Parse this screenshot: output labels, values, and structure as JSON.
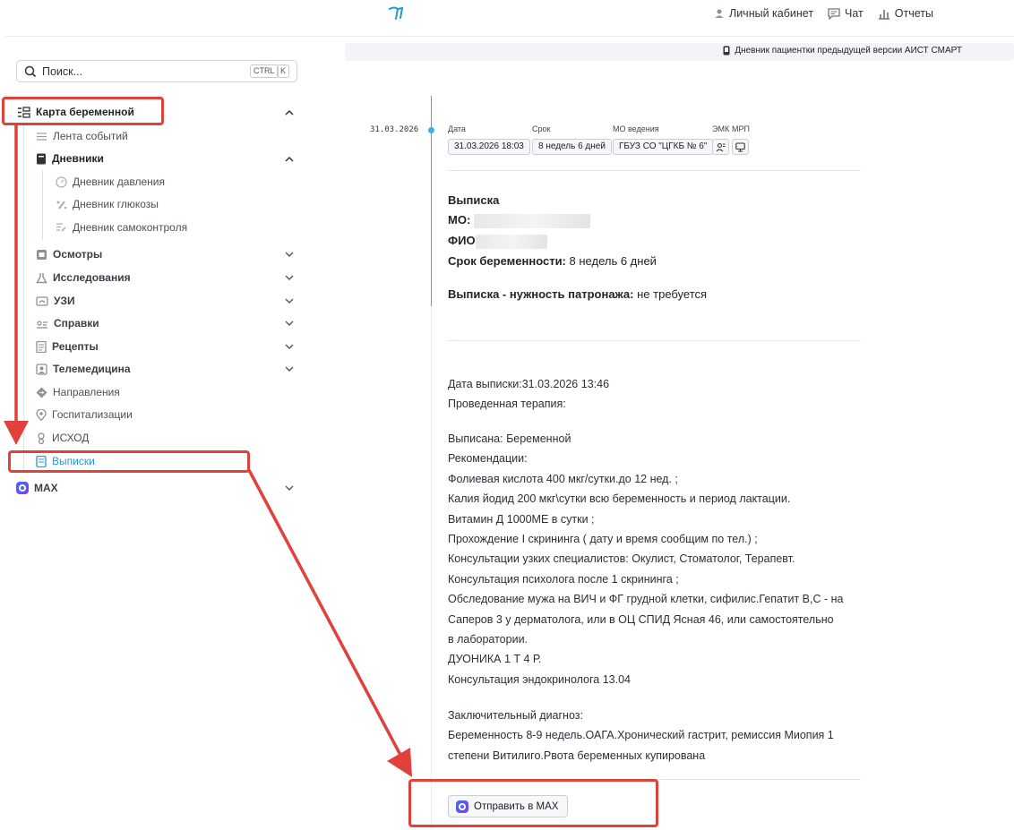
{
  "header": {
    "logo_icon": "stork-logo-icon",
    "nav": [
      {
        "label": "Личный кабинет",
        "icon": "user-icon"
      },
      {
        "label": "Чат",
        "icon": "chat-icon"
      },
      {
        "label": "Отчеты",
        "icon": "chart-icon"
      }
    ]
  },
  "banner": {
    "label": "Дневник пациентки предыдущей версии АИСТ СМАРТ",
    "icon": "phone-icon"
  },
  "search": {
    "placeholder": "Поиск...",
    "kbd1": "CTRL",
    "kbd2": "K"
  },
  "sidebar": {
    "root_label": "Карта беременной",
    "items": {
      "events": "Лента событий",
      "diaries": "Дневники",
      "pressure": "Дневник давления",
      "glucose": "Дневник глюкозы",
      "selfcontrol": "Дневник самоконтроля",
      "exams": "Осмотры",
      "research": "Исследования",
      "uzi": "УЗИ",
      "certificates": "Справки",
      "recipes": "Рецепты",
      "telemed": "Телемедицина",
      "referrals": "Направления",
      "hospital": "Госпитализации",
      "outcome": "ИСХОД",
      "extracts": "Выписки",
      "max": "MAX"
    }
  },
  "record": {
    "timeline_date": "31.03.2026",
    "labels": {
      "date": "Дата",
      "term": "Срок",
      "mo": "МО ведения",
      "emk": "ЭМК",
      "mrp": "МРП"
    },
    "date": "31.03.2026 18:03",
    "term": "8 недель 6 дней",
    "mo": "ГБУЗ СО \"ЦГКБ № 6\""
  },
  "extract": {
    "title": "Выписка",
    "mo_label": "МО:",
    "fio_label": "ФИО",
    "term_label": "Срок беременности:",
    "term_value": "8 недель 6 дней",
    "patronage_label": "Выписка - нужность патронажа:",
    "patronage_value": "не требуется"
  },
  "details": {
    "lines1": [
      "Дата выписки:31.03.2026 13:46",
      "Проведенная терапия:"
    ],
    "lines2": [
      "Выписана: Беременной",
      "Рекомендации:",
      "Фолиевая кислота 400 мкг/сутки.до 12 нед. ;",
      "Калия йодид 200 мкг\\сутки всю беременность и период лактации.",
      "Витамин Д 1000МЕ в сутки ;",
      "Прохождение I скрининга ( дату и время сообщим по тел.) ;",
      "Консультации узких специалистов: Окулист, Стоматолог, Терапевт.",
      "Консультация психолога после 1 скрининга ;",
      "Обследование мужа на ВИЧ и ФГ грудной клетки, сифилис.Гепатит В,С - на",
      "Саперов 3 у дерматолога, или в ОЦ СПИД Ясная 46, или самостоятельно",
      "в лаборатории.",
      "ДУОНИКА 1 Т 4 Р.",
      "Консультация эндокринолога 13.04"
    ],
    "lines3": [
      "Заключительный диагноз:",
      "Беременность 8-9 недель.ОАГА.Хронический гастрит, ремиссия Миопия 1",
      "степени Витилиго.Рвота беременных купирована"
    ]
  },
  "send_button": {
    "label": "Отправить в MAX"
  },
  "colors": {
    "accent": "#1e9ad6",
    "annotation": "#e0413a"
  }
}
